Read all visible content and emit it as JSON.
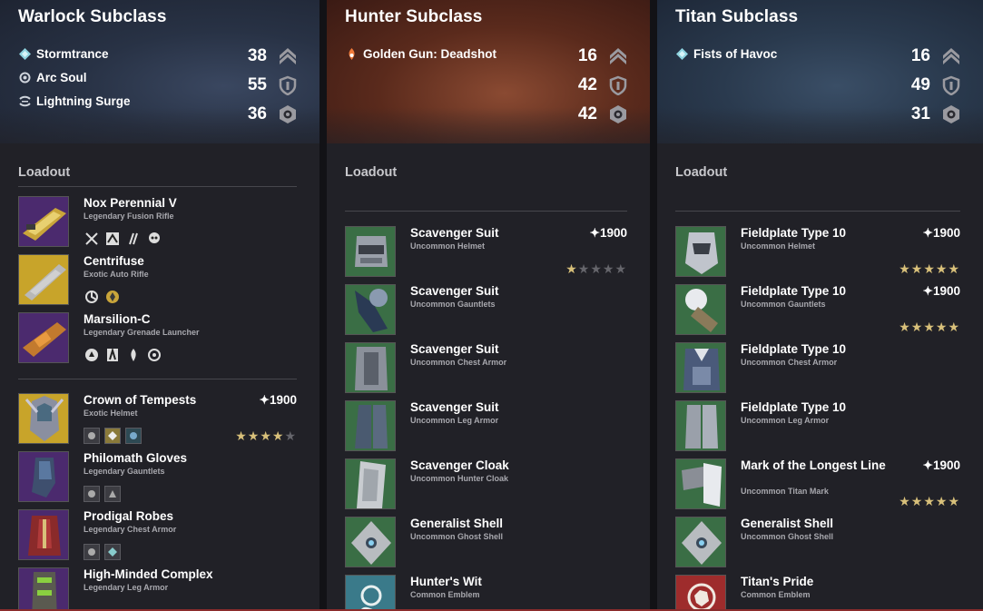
{
  "columns": [
    {
      "title": "Warlock Subclass",
      "abilities": [
        {
          "label": "Stormtrance",
          "icon": "diamond-icon"
        },
        {
          "label": "Arc Soul",
          "icon": "arc-soul-icon"
        },
        {
          "label": "Lightning Surge",
          "icon": "surge-icon"
        }
      ],
      "stats": [
        {
          "value": "38",
          "icon": "mobility-icon"
        },
        {
          "value": "55",
          "icon": "resilience-icon"
        },
        {
          "value": "36",
          "icon": "recovery-icon"
        }
      ],
      "loadout_label": "Loadout",
      "weapons": [
        {
          "name": "Nox Perennial V",
          "type": "Legendary Fusion Rifle",
          "perks": [
            "scope-perk-icon",
            "mag-perk-icon",
            "barrel-perk-icon",
            "skull-perk-icon"
          ]
        },
        {
          "name": "Centrifuse",
          "type": "Exotic Auto Rifle",
          "perks": [
            "spiral-perk-icon",
            "catalyst-perk-icon"
          ]
        },
        {
          "name": "Marsilion-C",
          "type": "Legendary Grenade Launcher",
          "perks": [
            "round-perk-icon",
            "spring-perk-icon",
            "flame-perk-icon",
            "target-perk-icon"
          ]
        }
      ],
      "armor": [
        {
          "name": "Crown of Tempests",
          "type": "Exotic Helmet",
          "power": "✦1900",
          "stars": 4
        },
        {
          "name": "Philomath Gloves",
          "type": "Legendary Gauntlets"
        },
        {
          "name": "Prodigal Robes",
          "type": "Legendary Chest Armor"
        },
        {
          "name": "High-Minded Complex",
          "type": "Legendary Leg Armor"
        }
      ]
    },
    {
      "title": "Hunter Subclass",
      "abilities": [
        {
          "label": "Golden Gun: Deadshot",
          "icon": "flame-icon"
        }
      ],
      "stats": [
        {
          "value": "16",
          "icon": "mobility-icon"
        },
        {
          "value": "42",
          "icon": "resilience-icon"
        },
        {
          "value": "42",
          "icon": "recovery-icon"
        }
      ],
      "loadout_label": "Loadout",
      "armor": [
        {
          "name": "Scavenger Suit",
          "type": "Uncommon Helmet",
          "power": "✦1900",
          "stars": 1
        },
        {
          "name": "Scavenger Suit",
          "type": "Uncommon Gauntlets"
        },
        {
          "name": "Scavenger Suit",
          "type": "Uncommon Chest Armor"
        },
        {
          "name": "Scavenger Suit",
          "type": "Uncommon Leg Armor"
        },
        {
          "name": "Scavenger Cloak",
          "type": "Uncommon Hunter Cloak"
        },
        {
          "name": "Generalist Shell",
          "type": "Uncommon Ghost Shell"
        },
        {
          "name": "Hunter's Wit",
          "type": "Common Emblem"
        }
      ]
    },
    {
      "title": "Titan Subclass",
      "abilities": [
        {
          "label": "Fists of Havoc",
          "icon": "diamond-icon"
        }
      ],
      "stats": [
        {
          "value": "16",
          "icon": "mobility-icon"
        },
        {
          "value": "49",
          "icon": "resilience-icon"
        },
        {
          "value": "31",
          "icon": "recovery-icon"
        }
      ],
      "loadout_label": "Loadout",
      "armor": [
        {
          "name": "Fieldplate Type 10",
          "type": "Uncommon Helmet",
          "power": "✦1900",
          "stars": 5
        },
        {
          "name": "Fieldplate Type 10",
          "type": "Uncommon Gauntlets",
          "power": "✦1900",
          "stars": 5
        },
        {
          "name": "Fieldplate Type 10",
          "type": "Uncommon Chest Armor"
        },
        {
          "name": "Fieldplate Type 10",
          "type": "Uncommon Leg Armor"
        },
        {
          "name": "Mark of the Longest Line",
          "type": "Uncommon Titan Mark",
          "power": "✦1900",
          "stars": 5
        },
        {
          "name": "Generalist Shell",
          "type": "Uncommon Ghost Shell"
        },
        {
          "name": "Titan's Pride",
          "type": "Common Emblem"
        }
      ]
    }
  ],
  "colors": {
    "uncommon": "#3a6e45",
    "legendary": "#4b2a6e",
    "exotic": "#c8a42a",
    "star": "#d8c07a",
    "star_off": "#65656b"
  }
}
